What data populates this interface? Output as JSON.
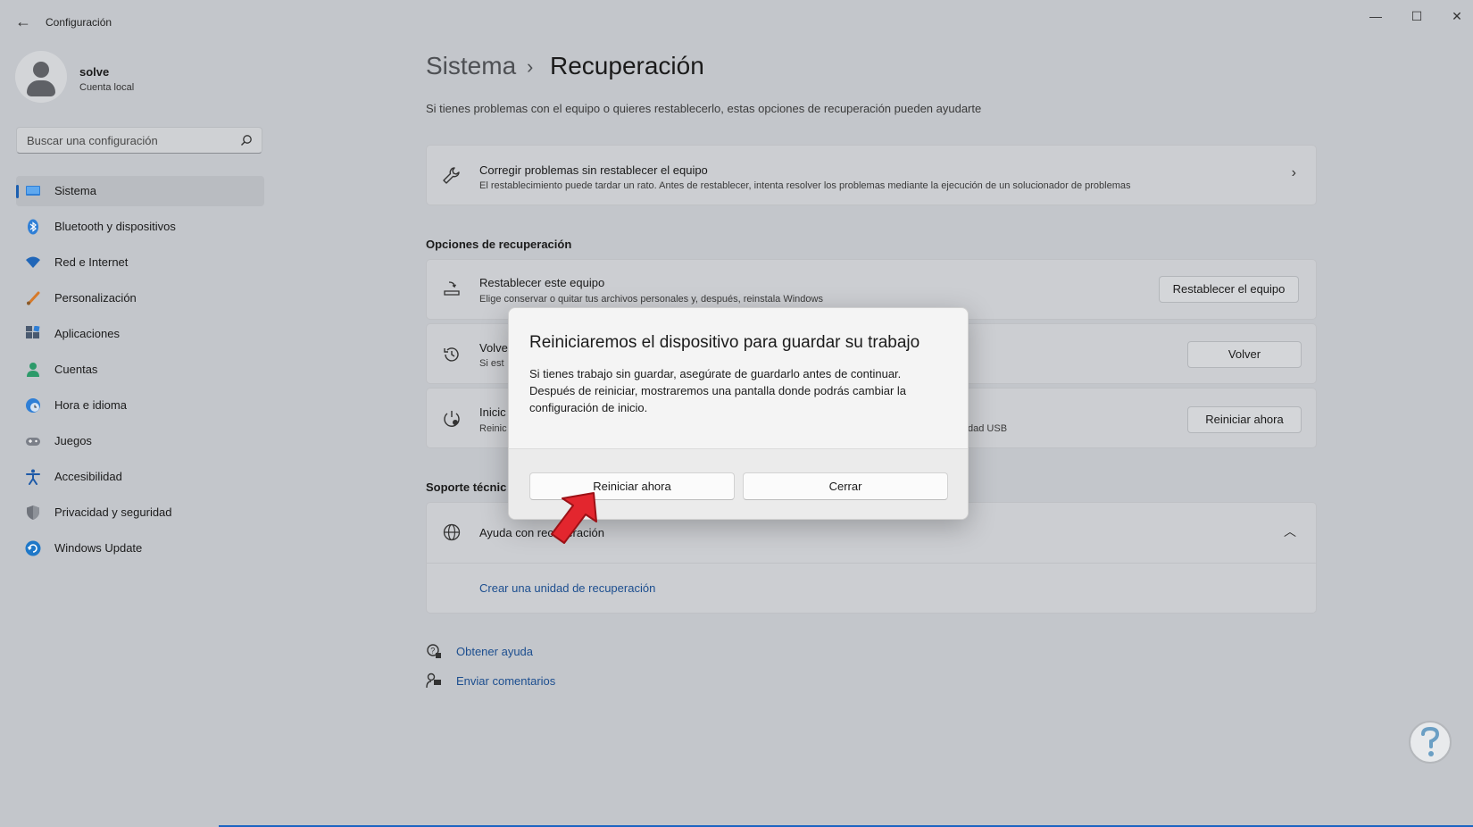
{
  "window": {
    "title": "Configuración"
  },
  "user": {
    "name": "solve",
    "type": "Cuenta local"
  },
  "search": {
    "placeholder": "Buscar una configuración"
  },
  "sidebar": {
    "items": [
      {
        "label": "Sistema",
        "icon": "system-icon",
        "active": true
      },
      {
        "label": "Bluetooth y dispositivos",
        "icon": "bluetooth-icon"
      },
      {
        "label": "Red e Internet",
        "icon": "wifi-icon"
      },
      {
        "label": "Personalización",
        "icon": "brush-icon"
      },
      {
        "label": "Aplicaciones",
        "icon": "apps-icon"
      },
      {
        "label": "Cuentas",
        "icon": "accounts-icon"
      },
      {
        "label": "Hora e idioma",
        "icon": "clock-globe-icon"
      },
      {
        "label": "Juegos",
        "icon": "gamepad-icon"
      },
      {
        "label": "Accesibilidad",
        "icon": "accessibility-icon"
      },
      {
        "label": "Privacidad y seguridad",
        "icon": "shield-icon"
      },
      {
        "label": "Windows Update",
        "icon": "update-icon"
      }
    ]
  },
  "main": {
    "breadcrumb": {
      "parent": "Sistema",
      "separator": "›",
      "current": "Recuperación"
    },
    "subtitle": "Si tienes problemas con el equipo o quieres restablecerlo, estas opciones de recuperación pueden ayudarte",
    "fix_card": {
      "title": "Corregir problemas sin restablecer el equipo",
      "desc": "El restablecimiento puede tardar un rato. Antes de restablecer, intenta resolver los problemas mediante la ejecución de un solucionador de problemas"
    },
    "recovery_section": "Opciones de recuperación",
    "reset_card": {
      "title": "Restablecer este equipo",
      "desc": "Elige conservar o quitar tus archivos personales y, después, reinstala Windows",
      "button": "Restablecer el equipo"
    },
    "goback_card": {
      "title": "Volve",
      "desc": "Si est",
      "button": "Volver"
    },
    "advanced_card": {
      "title": "Inicic",
      "desc": "Reinic",
      "desc_tail": "dad USB",
      "button": "Reiniciar ahora"
    },
    "support_section": "Soporte técnic",
    "help_card": {
      "title": "Ayuda con recuperación",
      "link": "Crear una unidad de recuperación"
    },
    "footer_links": {
      "help": "Obtener ayuda",
      "feedback": "Enviar comentarios"
    }
  },
  "dialog": {
    "title": "Reiniciaremos el dispositivo para guardar su trabajo",
    "body": "Si tienes trabajo sin guardar, asegúrate de guardarlo antes de continuar. Después de reiniciar, mostraremos una pantalla donde podrás cambiar la configuración de inicio.",
    "primary": "Reiniciar ahora",
    "secondary": "Cerrar"
  },
  "colors": {
    "accent": "#1b5fb0",
    "overlay": "#c3c6cb",
    "arrow": "#e3262e"
  }
}
